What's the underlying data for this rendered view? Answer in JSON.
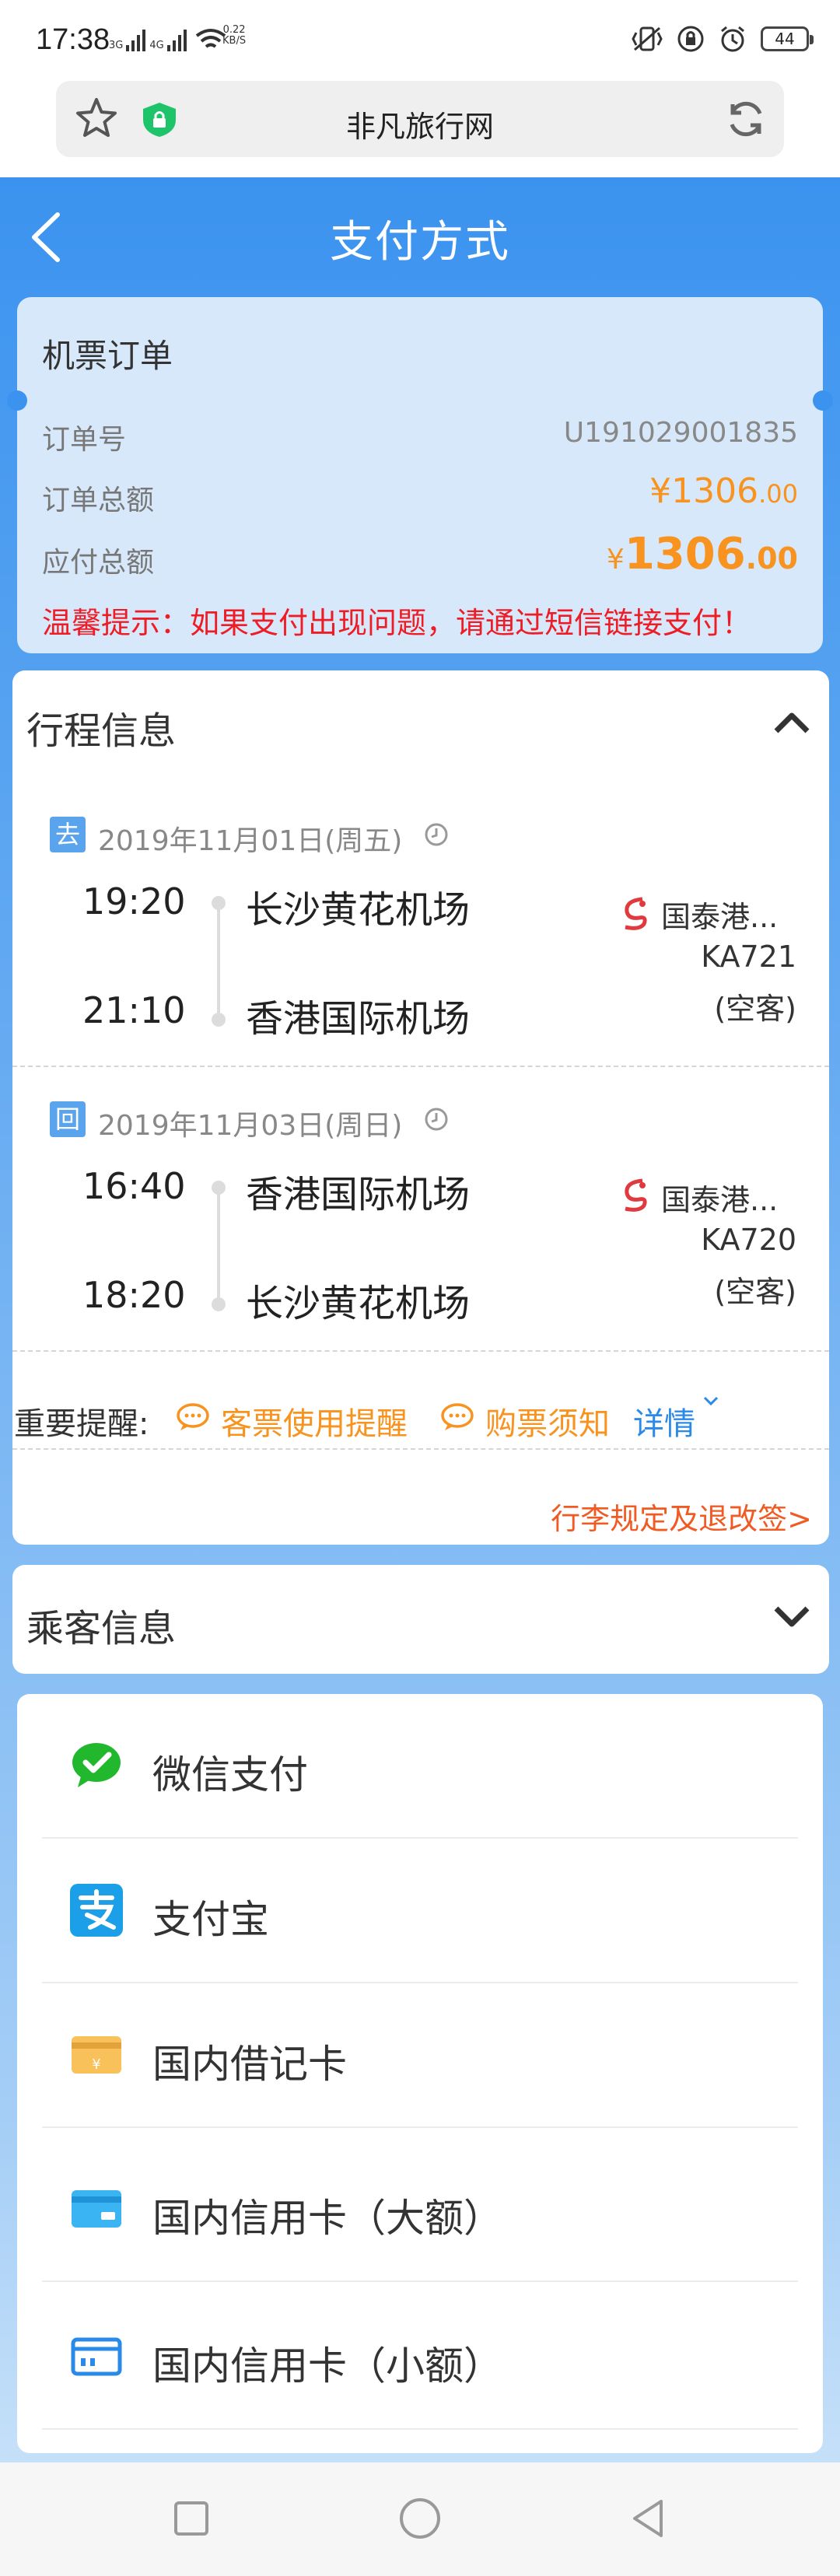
{
  "status_bar": {
    "time": "17:38",
    "network_1": "3G",
    "network_2": "4G",
    "speed_value": "0.22",
    "speed_unit": "KB/S",
    "battery": "44"
  },
  "browser": {
    "title": "非凡旅行网"
  },
  "header": {
    "title": "支付方式"
  },
  "order": {
    "title": "机票订单",
    "order_no_label": "订单号",
    "order_no": "U191029001835",
    "total_label": "订单总额",
    "total_currency": "¥",
    "total_int": "1306",
    "total_dec": ".00",
    "payable_label": "应付总额",
    "payable_currency": "¥",
    "payable_int": "1306",
    "payable_dec": ".00",
    "warning": "温馨提示：如果支付出现问题，请通过短信链接支付！"
  },
  "trip": {
    "title": "行程信息",
    "segments": [
      {
        "tag": "去",
        "date": "2019年11月01日(周五)",
        "dep_time": "19:20",
        "dep_airport": "长沙黄花机场",
        "arr_time": "21:10",
        "arr_airport": "香港国际机场",
        "airline": "国泰港...",
        "flight_no": "KA721",
        "aircraft": "(空客)"
      },
      {
        "tag": "回",
        "date": "2019年11月03日(周日)",
        "dep_time": "16:40",
        "dep_airport": "香港国际机场",
        "arr_time": "18:20",
        "arr_airport": "长沙黄花机场",
        "airline": "国泰港...",
        "flight_no": "KA720",
        "aircraft": "(空客)"
      }
    ],
    "reminder_label": "重要提醒:",
    "reminder_link_1": "客票使用提醒",
    "reminder_link_2": "购票须知",
    "reminder_detail": "详情",
    "luggage_link": "行李规定及退改签>"
  },
  "passenger": {
    "title": "乘客信息"
  },
  "payment_methods": [
    {
      "label": "微信支付",
      "icon": "wechat-pay-icon"
    },
    {
      "label": "支付宝",
      "icon": "alipay-icon"
    },
    {
      "label": "国内借记卡",
      "icon": "debit-card-icon"
    },
    {
      "label": "国内信用卡（大额）",
      "icon": "credit-card-large-icon"
    },
    {
      "label": "国内信用卡（小额）",
      "icon": "credit-card-small-icon"
    }
  ],
  "colors": {
    "primary_blue": "#3b93ef",
    "orange": "#f7931e",
    "warning_red": "#ee1c25",
    "link_blue": "#2a8ae8"
  }
}
